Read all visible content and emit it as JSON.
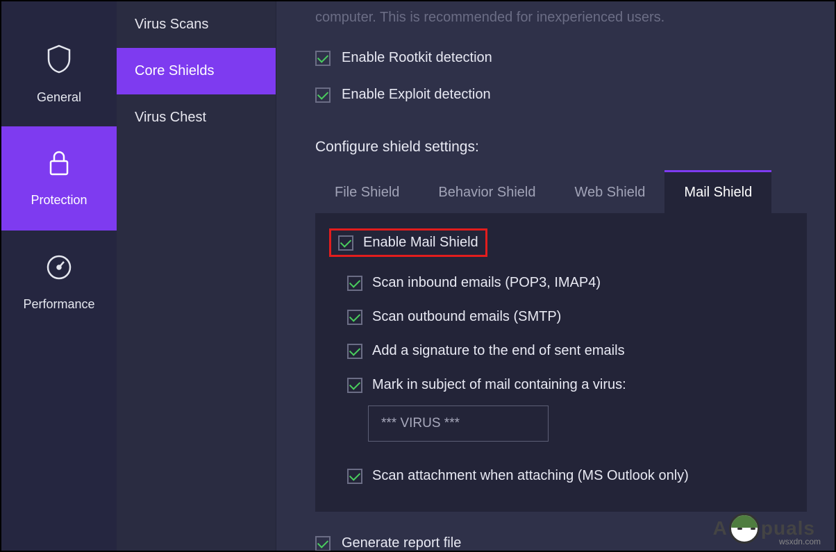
{
  "primaryNav": {
    "general": "General",
    "protection": "Protection",
    "performance": "Performance"
  },
  "secondaryNav": {
    "virusScans": "Virus Scans",
    "coreShields": "Core Shields",
    "virusChest": "Virus Chest"
  },
  "header": {
    "truncatedInfo": "computer. This is recommended for inexperienced users."
  },
  "topOptions": {
    "rootkit": "Enable Rootkit detection",
    "exploit": "Enable Exploit detection"
  },
  "sectionTitle": "Configure shield settings:",
  "tabs": {
    "file": "File Shield",
    "behavior": "Behavior Shield",
    "web": "Web Shield",
    "mail": "Mail Shield"
  },
  "mailShield": {
    "enable": "Enable Mail Shield",
    "scanInbound": "Scan inbound emails (POP3, IMAP4)",
    "scanOutbound": "Scan outbound emails (SMTP)",
    "addSig": "Add a signature to the end of sent emails",
    "markSubject": "Mark in subject of mail containing a virus:",
    "virusTag": "*** VIRUS ***",
    "scanAttach": "Scan attachment when attaching (MS Outlook only)"
  },
  "bottom": {
    "generateReport": "Generate report file"
  },
  "watermark": {
    "left": "A",
    "right": "puals",
    "src": "wsxdn.com"
  }
}
